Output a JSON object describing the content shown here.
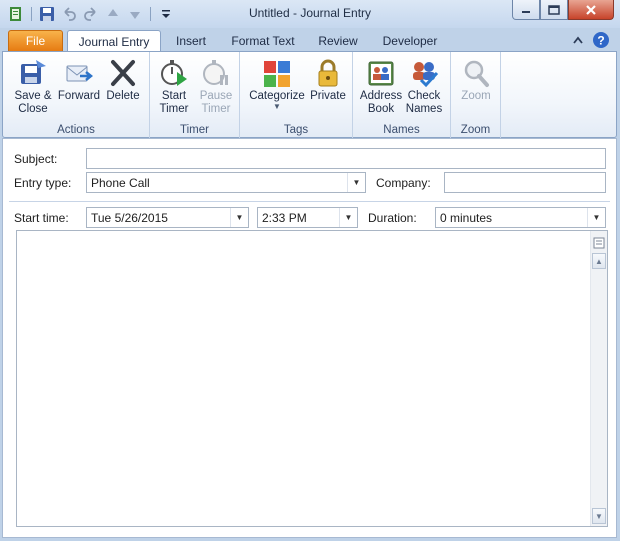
{
  "window": {
    "title": "Untitled  -  Journal Entry"
  },
  "tabs": {
    "file": "File",
    "journal_entry": "Journal Entry",
    "insert": "Insert",
    "format_text": "Format Text",
    "review": "Review",
    "developer": "Developer"
  },
  "ribbon": {
    "actions": {
      "label": "Actions",
      "save_close_1": "Save &",
      "save_close_2": "Close",
      "forward": "Forward",
      "delete": "Delete"
    },
    "timer": {
      "label": "Timer",
      "start_1": "Start",
      "start_2": "Timer",
      "pause_1": "Pause",
      "pause_2": "Timer"
    },
    "tags": {
      "label": "Tags",
      "categorize": "Categorize",
      "private": "Private"
    },
    "names": {
      "label": "Names",
      "address_1": "Address",
      "address_2": "Book",
      "check_1": "Check",
      "check_2": "Names"
    },
    "zoom": {
      "label": "Zoom",
      "zoom": "Zoom"
    }
  },
  "form": {
    "subject_label": "Subject:",
    "subject_value": "",
    "entry_type_label": "Entry type:",
    "entry_type_value": "Phone Call",
    "company_label": "Company:",
    "company_value": "",
    "start_time_label": "Start time:",
    "start_date_value": "Tue 5/26/2015",
    "start_time_value": "2:33 PM",
    "duration_label": "Duration:",
    "duration_value": "0 minutes",
    "notes_value": ""
  }
}
